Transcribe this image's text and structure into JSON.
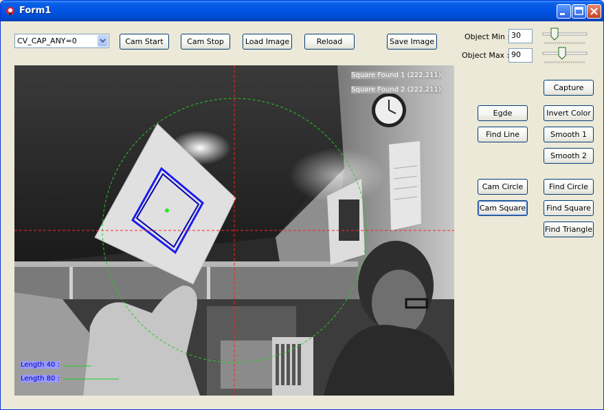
{
  "window": {
    "title": "Form1"
  },
  "toolbar": {
    "camera_select": "CV_CAP_ANY=0",
    "cam_start": "Cam Start",
    "cam_stop": "Cam Stop",
    "load_image": "Load Image",
    "reload": "Reload",
    "save_image": "Save Image"
  },
  "object_controls": {
    "min_label": "Object Min :",
    "min_value": "30",
    "max_label": "Object Max :",
    "max_value": "90"
  },
  "side_buttons": {
    "capture": "Capture",
    "edge": "Egde",
    "invert_color": "Invert Color",
    "find_line": "Find Line",
    "smooth1": "Smooth 1",
    "smooth2": "Smooth 2",
    "cam_circle": "Cam Circle",
    "find_circle": "Find Circle",
    "cam_square": "Cam Square",
    "find_square": "Find Square",
    "find_triangle": "Find Triangle"
  },
  "overlay": {
    "square1": "Square Found 1 (222,211)",
    "square2": "Square Found 2 (222,211)",
    "length40": "Length 40 :",
    "length80": "Length 80 :"
  },
  "colors": {
    "crosshair": "#ff2020",
    "circle": "#22cc22",
    "square": "#1a1aee",
    "label_bg": "#9999ff"
  },
  "icons": [
    "app-icon",
    "minimize-icon",
    "maximize-icon",
    "close-icon",
    "dropdown-arrow-icon"
  ]
}
